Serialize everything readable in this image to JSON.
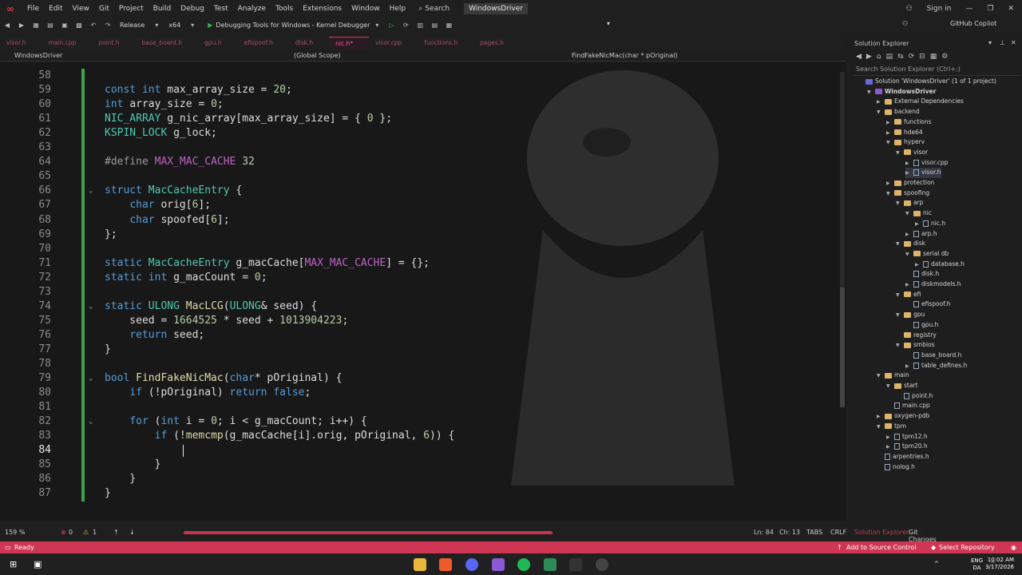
{
  "menu": {
    "items": [
      "File",
      "Edit",
      "View",
      "Git",
      "Project",
      "Build",
      "Debug",
      "Test",
      "Analyze",
      "Tools",
      "Extensions",
      "Window",
      "Help"
    ],
    "search_label": "Search",
    "solution_name": "WindowsDriver",
    "sign_in": "Sign in"
  },
  "toolbar": {
    "configuration": "Release",
    "platform": "x64",
    "debugger": "Debugging Tools for Windows - Kernel Debugger",
    "copilot": "GitHub Copilot"
  },
  "tabs": [
    {
      "label": "visor.h",
      "active": false
    },
    {
      "label": "main.cpp",
      "active": false
    },
    {
      "label": "point.h",
      "active": false
    },
    {
      "label": "base_board.h",
      "active": false
    },
    {
      "label": "gpu.h",
      "active": false
    },
    {
      "label": "efispoof.h",
      "active": false
    },
    {
      "label": "disk.h",
      "active": false
    },
    {
      "label": "nic.h*",
      "active": true
    },
    {
      "label": "visor.cpp",
      "active": false
    },
    {
      "label": "functions.h",
      "active": false
    },
    {
      "label": "pages.h",
      "active": false
    }
  ],
  "navbar": {
    "project": "WindowsDriver",
    "scope": "(Global Scope)",
    "member": "FindFakeNicMac(char * pOriginal)"
  },
  "editor": {
    "lines": [
      {
        "n": "58",
        "fold": false,
        "segs": []
      },
      {
        "n": "59",
        "fold": false,
        "segs": [
          [
            "kw",
            "const "
          ],
          [
            "kw",
            "int "
          ],
          [
            "id",
            "max_array_size = "
          ],
          [
            "num",
            "20"
          ],
          [
            "id",
            ";"
          ]
        ]
      },
      {
        "n": "60",
        "fold": false,
        "segs": [
          [
            "kw",
            "int "
          ],
          [
            "id",
            "array_size = "
          ],
          [
            "num",
            "0"
          ],
          [
            "id",
            ";"
          ]
        ]
      },
      {
        "n": "61",
        "fold": false,
        "segs": [
          [
            "ty",
            "NIC_ARRAY "
          ],
          [
            "id",
            "g_nic_array[max_array_size] = { "
          ],
          [
            "num",
            "0"
          ],
          [
            "id",
            " };"
          ]
        ]
      },
      {
        "n": "62",
        "fold": false,
        "segs": [
          [
            "ty",
            "KSPIN_LOCK "
          ],
          [
            "id",
            "g_lock;"
          ]
        ]
      },
      {
        "n": "63",
        "fold": false,
        "segs": []
      },
      {
        "n": "64",
        "fold": false,
        "segs": [
          [
            "pre",
            "#define "
          ],
          [
            "mac",
            "MAX_MAC_CACHE "
          ],
          [
            "num",
            "32"
          ]
        ]
      },
      {
        "n": "65",
        "fold": false,
        "segs": []
      },
      {
        "n": "66",
        "fold": true,
        "segs": [
          [
            "kw",
            "struct "
          ],
          [
            "ty",
            "MacCacheEntry "
          ],
          [
            "id",
            "{"
          ]
        ]
      },
      {
        "n": "67",
        "fold": false,
        "segs": [
          [
            "id",
            "    "
          ],
          [
            "kw",
            "char "
          ],
          [
            "id",
            "orig["
          ],
          [
            "num",
            "6"
          ],
          [
            "id",
            "];"
          ]
        ]
      },
      {
        "n": "68",
        "fold": false,
        "segs": [
          [
            "id",
            "    "
          ],
          [
            "kw",
            "char "
          ],
          [
            "id",
            "spoofed["
          ],
          [
            "num",
            "6"
          ],
          [
            "id",
            "];"
          ]
        ]
      },
      {
        "n": "69",
        "fold": false,
        "segs": [
          [
            "id",
            "};"
          ]
        ]
      },
      {
        "n": "70",
        "fold": false,
        "segs": []
      },
      {
        "n": "71",
        "fold": false,
        "segs": [
          [
            "kw",
            "static "
          ],
          [
            "ty",
            "MacCacheEntry "
          ],
          [
            "id",
            "g_macCache["
          ],
          [
            "mac",
            "MAX_MAC_CACHE"
          ],
          [
            "id",
            "] = {};"
          ]
        ]
      },
      {
        "n": "72",
        "fold": false,
        "segs": [
          [
            "kw",
            "static "
          ],
          [
            "kw",
            "int "
          ],
          [
            "id",
            "g_macCount = "
          ],
          [
            "num",
            "0"
          ],
          [
            "id",
            ";"
          ]
        ]
      },
      {
        "n": "73",
        "fold": false,
        "segs": []
      },
      {
        "n": "74",
        "fold": true,
        "segs": [
          [
            "kw",
            "static "
          ],
          [
            "ty",
            "ULONG "
          ],
          [
            "fn",
            "MacLCG"
          ],
          [
            "id",
            "("
          ],
          [
            "ty",
            "ULONG"
          ],
          [
            "id",
            "& seed) {"
          ]
        ]
      },
      {
        "n": "75",
        "fold": false,
        "segs": [
          [
            "id",
            "    seed = "
          ],
          [
            "num",
            "1664525"
          ],
          [
            "id",
            " * seed + "
          ],
          [
            "num",
            "1013904223"
          ],
          [
            "id",
            ";"
          ]
        ]
      },
      {
        "n": "76",
        "fold": false,
        "segs": [
          [
            "id",
            "    "
          ],
          [
            "kw",
            "return "
          ],
          [
            "id",
            "seed;"
          ]
        ]
      },
      {
        "n": "77",
        "fold": false,
        "segs": [
          [
            "id",
            "}"
          ]
        ]
      },
      {
        "n": "78",
        "fold": false,
        "segs": []
      },
      {
        "n": "79",
        "fold": true,
        "segs": [
          [
            "kw",
            "bool "
          ],
          [
            "fn",
            "FindFakeNicMac"
          ],
          [
            "id",
            "("
          ],
          [
            "kw",
            "char"
          ],
          [
            "id",
            "* pOriginal) {"
          ]
        ]
      },
      {
        "n": "80",
        "fold": false,
        "segs": [
          [
            "id",
            "    "
          ],
          [
            "kw",
            "if "
          ],
          [
            "id",
            "(!pOriginal) "
          ],
          [
            "kw",
            "return "
          ],
          [
            "kw",
            "false"
          ],
          [
            "id",
            ";"
          ]
        ]
      },
      {
        "n": "81",
        "fold": false,
        "segs": []
      },
      {
        "n": "82",
        "fold": true,
        "segs": [
          [
            "id",
            "    "
          ],
          [
            "kw",
            "for "
          ],
          [
            "id",
            "("
          ],
          [
            "kw",
            "int "
          ],
          [
            "id",
            "i = "
          ],
          [
            "num",
            "0"
          ],
          [
            "id",
            "; i < g_macCount; i++) {"
          ]
        ]
      },
      {
        "n": "83",
        "fold": false,
        "segs": [
          [
            "id",
            "        "
          ],
          [
            "kw",
            "if "
          ],
          [
            "id",
            "(!"
          ],
          [
            "fn",
            "memcmp"
          ],
          [
            "id",
            "(g_macCache[i].orig, pOriginal, "
          ],
          [
            "num",
            "6"
          ],
          [
            "id",
            ")) {"
          ]
        ]
      },
      {
        "n": "84",
        "fold": false,
        "segs": []
      },
      {
        "n": "85",
        "fold": false,
        "segs": [
          [
            "id",
            "        }"
          ]
        ]
      },
      {
        "n": "86",
        "fold": false,
        "segs": [
          [
            "id",
            "    }"
          ]
        ]
      },
      {
        "n": "87",
        "fold": false,
        "segs": [
          [
            "id",
            "}"
          ]
        ]
      }
    ]
  },
  "editor_status": {
    "zoom": "159 %",
    "errors": "0",
    "warnings": "1",
    "ln": "Ln: 84",
    "ch": "Ch: 13",
    "tabs": "TABS",
    "eol": "CRLF"
  },
  "solution_explorer": {
    "title": "Solution Explorer",
    "search_placeholder": "Search Solution Explorer (Ctrl+;)",
    "tabs": [
      "Solution Explorer",
      "Git Changes"
    ],
    "nodes": [
      {
        "label": "Solution 'WindowsDriver' (1 of 1 project)",
        "depth": 0,
        "kind": "sol",
        "arrow": ""
      },
      {
        "label": "WindowsDriver",
        "depth": 1,
        "kind": "proj",
        "arrow": "▼"
      },
      {
        "label": "External Dependencies",
        "depth": 2,
        "kind": "folder",
        "arrow": "▶"
      },
      {
        "label": "backend",
        "depth": 2,
        "kind": "folder",
        "arrow": "▼"
      },
      {
        "label": "functions",
        "depth": 3,
        "kind": "folder",
        "arrow": "▶"
      },
      {
        "label": "hde64",
        "depth": 3,
        "kind": "folder",
        "arrow": "▶"
      },
      {
        "label": "hyperv",
        "depth": 3,
        "kind": "folder",
        "arrow": "▼"
      },
      {
        "label": "visor",
        "depth": 4,
        "kind": "folder",
        "arrow": "▼"
      },
      {
        "label": "visor.cpp",
        "depth": 5,
        "kind": "file",
        "arrow": "▶"
      },
      {
        "label": "visor.h",
        "depth": 5,
        "kind": "file",
        "arrow": "▶"
      },
      {
        "label": "protection",
        "depth": 3,
        "kind": "folder",
        "arrow": "▶"
      },
      {
        "label": "spoofing",
        "depth": 3,
        "kind": "folder",
        "arrow": "▼"
      },
      {
        "label": "arp",
        "depth": 4,
        "kind": "folder",
        "arrow": "▼"
      },
      {
        "label": "nic",
        "depth": 5,
        "kind": "folder",
        "arrow": "▼"
      },
      {
        "label": "nic.h",
        "depth": 6,
        "kind": "file",
        "arrow": "▶"
      },
      {
        "label": "arp.h",
        "depth": 5,
        "kind": "file",
        "arrow": "▶"
      },
      {
        "label": "disk",
        "depth": 4,
        "kind": "folder",
        "arrow": "▼"
      },
      {
        "label": "serial db",
        "depth": 5,
        "kind": "folder",
        "arrow": "▼"
      },
      {
        "label": "database.h",
        "depth": 6,
        "kind": "file",
        "arrow": "▶"
      },
      {
        "label": "disk.h",
        "depth": 5,
        "kind": "file",
        "arrow": ""
      },
      {
        "label": "diskmodels.h",
        "depth": 5,
        "kind": "file",
        "arrow": "▶"
      },
      {
        "label": "efi",
        "depth": 4,
        "kind": "folder",
        "arrow": "▼"
      },
      {
        "label": "efispoof.h",
        "depth": 5,
        "kind": "file",
        "arrow": ""
      },
      {
        "label": "gpu",
        "depth": 4,
        "kind": "folder",
        "arrow": "▼"
      },
      {
        "label": "gpu.h",
        "depth": 5,
        "kind": "file",
        "arrow": ""
      },
      {
        "label": "registry",
        "depth": 4,
        "kind": "folder",
        "arrow": ""
      },
      {
        "label": "smbios",
        "depth": 4,
        "kind": "folder",
        "arrow": "▼"
      },
      {
        "label": "base_board.h",
        "depth": 5,
        "kind": "file",
        "arrow": ""
      },
      {
        "label": "table_defines.h",
        "depth": 5,
        "kind": "file",
        "arrow": "▶"
      },
      {
        "label": "main",
        "depth": 2,
        "kind": "folder",
        "arrow": "▼"
      },
      {
        "label": "start",
        "depth": 3,
        "kind": "folder",
        "arrow": "▼"
      },
      {
        "label": "point.h",
        "depth": 4,
        "kind": "file",
        "arrow": ""
      },
      {
        "label": "main.cpp",
        "depth": 3,
        "kind": "file",
        "arrow": ""
      },
      {
        "label": "oxygen-pdb",
        "depth": 2,
        "kind": "folder",
        "arrow": "▶"
      },
      {
        "label": "tpm",
        "depth": 2,
        "kind": "folder",
        "arrow": "▼"
      },
      {
        "label": "tpm12.h",
        "depth": 3,
        "kind": "file",
        "arrow": "▶"
      },
      {
        "label": "tpm20.h",
        "depth": 3,
        "kind": "file",
        "arrow": "▶"
      },
      {
        "label": "arpentries.h",
        "depth": 2,
        "kind": "file",
        "arrow": ""
      },
      {
        "label": "nolog.h",
        "depth": 2,
        "kind": "file",
        "arrow": ""
      }
    ]
  },
  "statusbar": {
    "ready": "Ready",
    "add_source": "Add to Source Control",
    "select_repo": "Select Repository"
  },
  "taskbar": {
    "lang": "ENG",
    "region": "DA",
    "time": "10:02 AM",
    "date": "3/17/2026"
  },
  "colors": {
    "accent": "#cf3654",
    "keyword": "#569cd6",
    "type": "#4ec9b0",
    "function": "#dcdcaa",
    "number": "#b5cea8",
    "macro": "#bd63c5"
  }
}
